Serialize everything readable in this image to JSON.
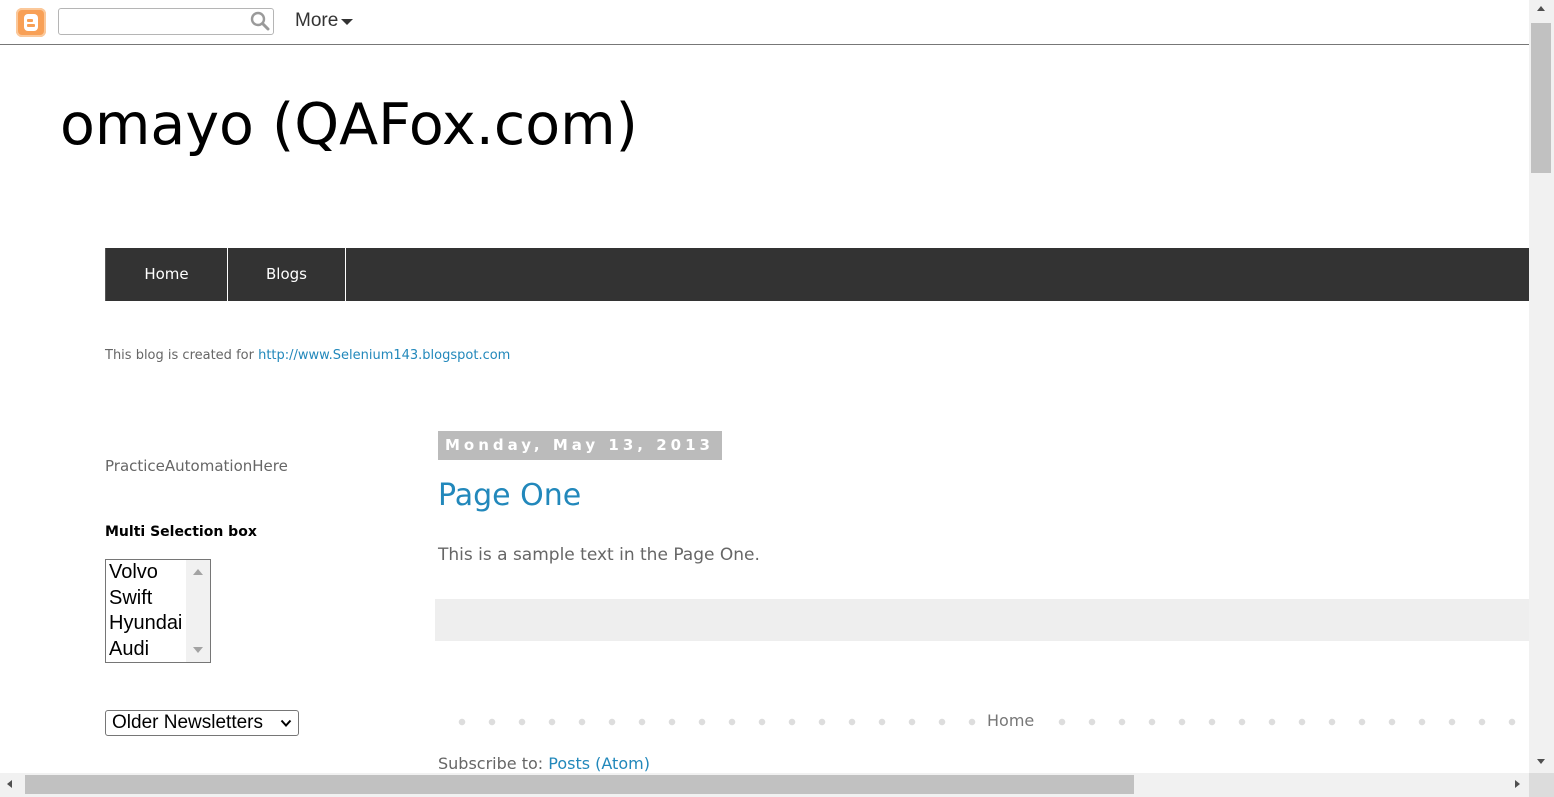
{
  "navbar": {
    "logo_icon": "blogger-logo-icon",
    "search_value": "",
    "search_icon": "search-icon",
    "more_label": "More"
  },
  "header": {
    "title": "omayo (QAFox.com)"
  },
  "tabs": [
    {
      "label": "Home"
    },
    {
      "label": "Blogs"
    }
  ],
  "description": {
    "text": "This blog is created for ",
    "link_text": "http://www.Selenium143.blogspot.com"
  },
  "sidebar": {
    "text_widget": "PracticeAutomationHere",
    "multi_select": {
      "title": "Multi Selection box",
      "options": [
        "Volvo",
        "Swift",
        "Hyundai",
        "Audi"
      ]
    },
    "dropdown": {
      "selected": "Older Newsletters"
    }
  },
  "post": {
    "date": "Monday, May 13, 2013",
    "title": "Page One",
    "body": "This is a sample text in the Page One."
  },
  "footer": {
    "home_link": "Home",
    "subscribe_label": "Subscribe to: ",
    "subscribe_link": "Posts (Atom)"
  },
  "colors": {
    "link": "#2288bb",
    "tab_bar": "#333333",
    "date_header_bg": "#bbbbbb",
    "post_footer_bg": "#eeeeee",
    "blogger_orange": "#f8a056"
  }
}
